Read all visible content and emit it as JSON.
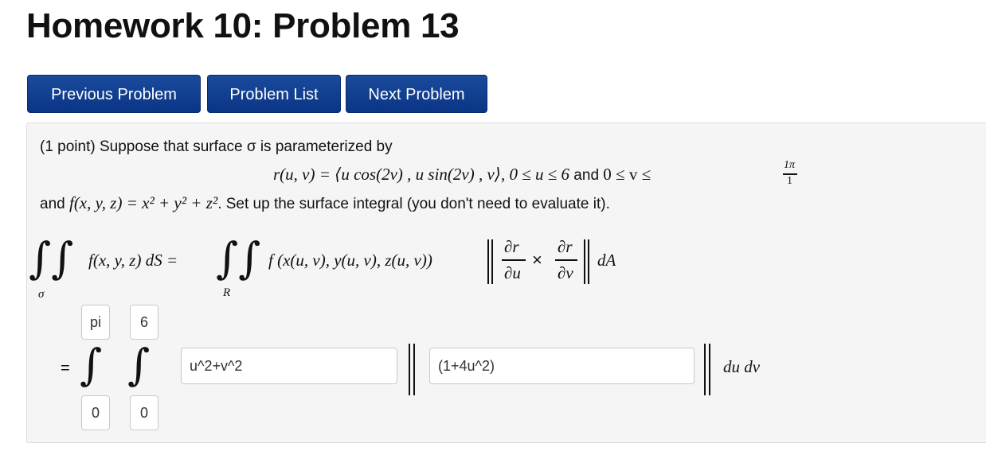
{
  "page": {
    "title": "Homework 10: Problem 13"
  },
  "nav": {
    "previous": "Previous Problem",
    "list": "Problem List",
    "next": "Next Problem"
  },
  "problem": {
    "intro": "(1 point) Suppose that surface σ is parameterized by",
    "param_lhs": "r(u, v) = ⟨u cos(2v) , u sin(2v) , v⟩, 0 ≤ u ≤ 6",
    "param_and": " and ",
    "param_v": "0 ≤ v ≤",
    "param_v_num": "1π",
    "param_v_den": "1",
    "f_prefix": "and ",
    "f_def": "f(x, y, z) = x² + y² + z²",
    "f_suffix": ". Set up the surface integral (you don't need to evaluate it).",
    "lhs_integrand": "f(x, y, z) dS =",
    "lhs_region": "σ",
    "rhs_integrand": "f (x(u, v), y(u, v), z(u, v))",
    "rhs_region": "R",
    "partial_num": "∂r",
    "partial_u": "∂u",
    "partial_v": "∂v",
    "cross": "×",
    "dA": "dA",
    "equals": "=",
    "du_dv": "du dv"
  },
  "answers": {
    "outer_upper": "pi",
    "outer_lower": "0",
    "inner_upper": "6",
    "inner_lower": "0",
    "integrand_f": "u^2+v^2",
    "integrand_norm": "(1+4u^2)"
  }
}
